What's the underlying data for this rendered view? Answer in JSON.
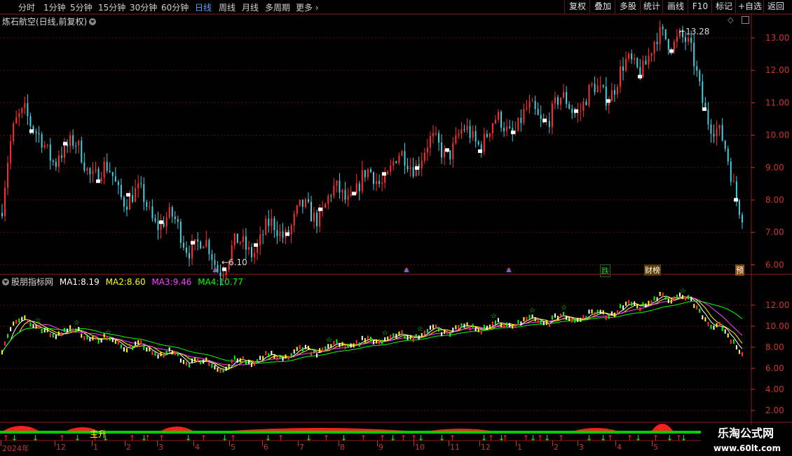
{
  "toolbar": {
    "periods": [
      "分时",
      "1分钟",
      "5分钟",
      "15分钟",
      "30分钟",
      "60分钟",
      "日线",
      "周线",
      "月线",
      "多周期",
      "更多"
    ],
    "active_period": "日线",
    "right_buttons": [
      "复权",
      "叠加",
      "多股",
      "统计",
      "画线",
      "F10",
      "标记",
      "+自选",
      "返回"
    ]
  },
  "chart_title": "炼石航空(日线,前复权)",
  "indicator": {
    "name": "股朋指标网",
    "ma1_label": "MA1:",
    "ma1_value": "8.19",
    "ma2_label": "MA2:",
    "ma2_value": "8.60",
    "ma3_label": "MA3:",
    "ma3_value": "9.46",
    "ma4_label": "MA4:",
    "ma4_value": "10.77",
    "colors": {
      "ma1": "#ffffff",
      "ma2": "#ffff00",
      "ma3": "#ff40ff",
      "ma4": "#00ff00"
    }
  },
  "price_axis": [
    "13.00",
    "12.00",
    "11.00",
    "10.00",
    "9.00",
    "8.00",
    "7.00",
    "6.00"
  ],
  "indicator_axis": [
    "12.00",
    "10.00",
    "8.00",
    "6.00",
    "4.00",
    "2.00"
  ],
  "annotations": {
    "high": "13.28",
    "low": "6.10"
  },
  "event_tags": [
    "跌",
    "财榜",
    "预"
  ],
  "bottom_label": "主升",
  "time_axis": [
    "2024年",
    "12",
    "1",
    "2",
    "3",
    "4",
    "5",
    "6",
    "7",
    "8",
    "9",
    "10",
    "11",
    "12",
    "1",
    "2",
    "3",
    "4",
    "5"
  ],
  "watermark": {
    "line1": "乐淘公式网",
    "line2": "www.60lt.com"
  },
  "chart_data": {
    "type": "candlestick",
    "price_range": [
      5.8,
      13.5
    ],
    "key_points": [
      {
        "label": "start",
        "value": 7.6
      },
      {
        "label": "spike",
        "value": 10.6
      },
      {
        "label": "low",
        "value": 6.1
      },
      {
        "label": "mid",
        "value": 9.4
      },
      {
        "label": "rally",
        "value": 11.2
      },
      {
        "label": "high",
        "value": 13.28
      },
      {
        "label": "last",
        "value": 7.6
      }
    ]
  }
}
